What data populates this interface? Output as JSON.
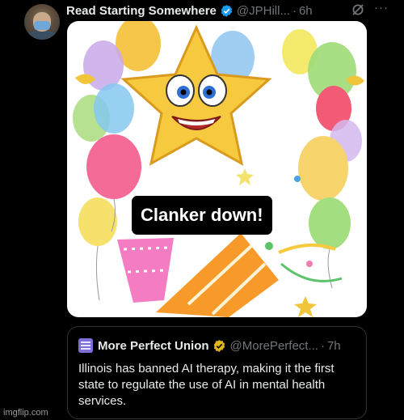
{
  "post": {
    "author_name": "Read Starting Somewhere",
    "handle": "@JPHill...",
    "separator": "·",
    "time": "6h",
    "more_icon": "more-icon",
    "grok_icon": "grok-icon",
    "verified_color": "#1d9bf0",
    "image_caption": "Clanker down!"
  },
  "quote": {
    "author_name": "More Perfect Union",
    "handle": "@MorePerfect...",
    "separator": "·",
    "time": "7h",
    "verified_color": "#e2b719",
    "text": "Illinois has banned AI therapy, making it the first state to regulate the use of AI in mental health services."
  },
  "watermark": "imgflip.com",
  "colors": {
    "background": "#000000",
    "text": "#e7e9ea",
    "muted": "#71767b",
    "border": "#2f3336"
  }
}
